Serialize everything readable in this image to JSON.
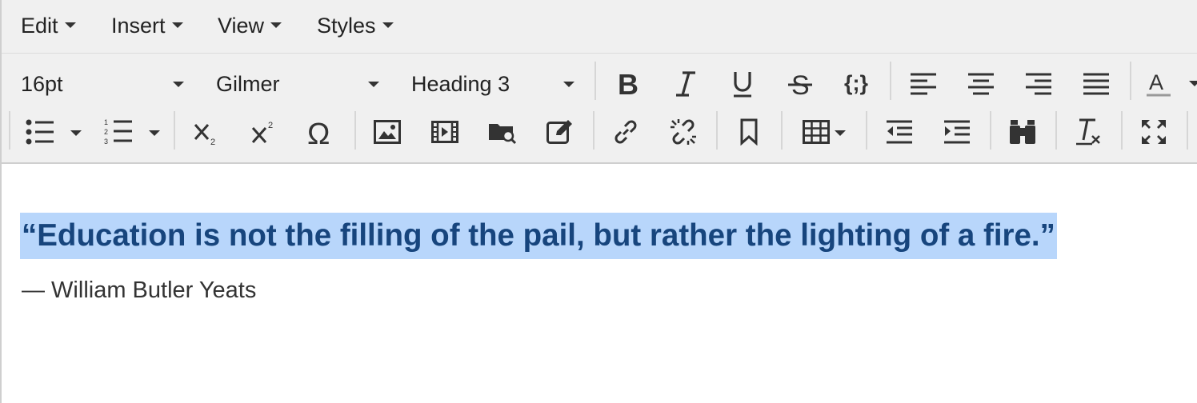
{
  "menubar": {
    "items": [
      {
        "label": "Edit"
      },
      {
        "label": "Insert"
      },
      {
        "label": "View"
      },
      {
        "label": "Styles"
      }
    ]
  },
  "toolbar": {
    "font_size": "16pt",
    "font_family": "Gilmer",
    "block_format": "Heading 3",
    "format_text_color_letter": "A"
  },
  "content": {
    "quote": "“Education is not the filling of the pail, but rather the lighting of a fire.”",
    "author": "— William Butler Yeats"
  },
  "colors": {
    "selection_highlight": "#b8d6fb",
    "heading_text": "#17457d",
    "toolbar_background": "#f0f0f0"
  },
  "icons": [
    "bold-icon",
    "italic-icon",
    "underline-icon",
    "strikethrough-icon",
    "code-icon",
    "align-left-icon",
    "align-center-icon",
    "align-right-icon",
    "align-justify-icon",
    "text-color-icon",
    "bullet-list-icon",
    "numbered-list-icon",
    "subscript-icon",
    "superscript-icon",
    "special-character-icon",
    "image-icon",
    "media-icon",
    "file-browser-icon",
    "edit-icon",
    "link-icon",
    "unlink-icon",
    "bookmark-icon",
    "table-icon",
    "outdent-icon",
    "indent-icon",
    "find-replace-icon",
    "clear-formatting-icon",
    "fullscreen-icon"
  ]
}
